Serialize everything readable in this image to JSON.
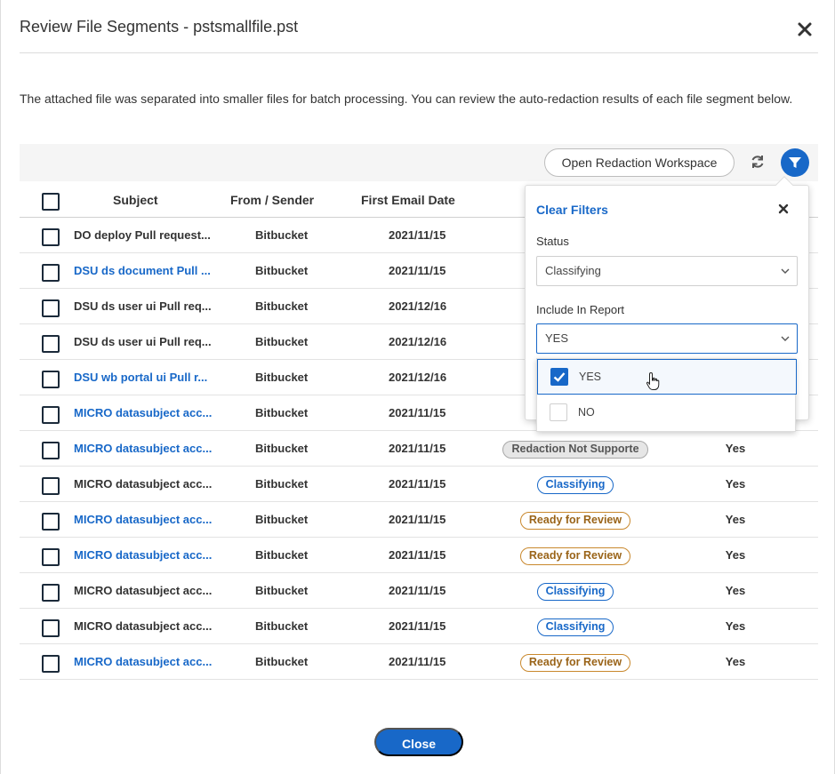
{
  "modal": {
    "title": "Review File Segments - pstsmallfile.pst",
    "description": "The attached file was separated into smaller files for batch processing. You can review the auto-redaction results of each file segment below."
  },
  "toolbar": {
    "open_workspace_label": "Open Redaction Workspace",
    "refresh_icon": "refresh-icon",
    "filter_icon": "filter-icon"
  },
  "table": {
    "columns": [
      "Subject",
      "From / Sender",
      "First Email Date"
    ],
    "rows": [
      {
        "subject": "DO deploy Pull request...",
        "link": false,
        "from": "Bitbucket",
        "date": "2021/11/15",
        "status": "",
        "status_type": "",
        "include": ""
      },
      {
        "subject": "DSU ds document Pull ...",
        "link": true,
        "from": "Bitbucket",
        "date": "2021/11/15",
        "status": "",
        "status_type": "review",
        "include": ""
      },
      {
        "subject": "DSU ds user ui Pull req...",
        "link": false,
        "from": "Bitbucket",
        "date": "2021/12/16",
        "status": "",
        "status_type": "",
        "include": ""
      },
      {
        "subject": "DSU ds user ui Pull req...",
        "link": false,
        "from": "Bitbucket",
        "date": "2021/12/16",
        "status": "",
        "status_type": "",
        "include": ""
      },
      {
        "subject": "DSU wb portal ui Pull r...",
        "link": true,
        "from": "Bitbucket",
        "date": "2021/12/16",
        "status": "",
        "status_type": "review",
        "include": ""
      },
      {
        "subject": "MICRO datasubject acc...",
        "link": true,
        "from": "Bitbucket",
        "date": "2021/11/15",
        "status": "",
        "status_type": "review",
        "include": ""
      },
      {
        "subject": "MICRO datasubject acc...",
        "link": true,
        "from": "Bitbucket",
        "date": "2021/11/15",
        "status": "Redaction Not Supporte",
        "status_type": "notsupported",
        "include": "Yes"
      },
      {
        "subject": "MICRO datasubject acc...",
        "link": false,
        "from": "Bitbucket",
        "date": "2021/11/15",
        "status": "Classifying",
        "status_type": "classifying",
        "include": "Yes"
      },
      {
        "subject": "MICRO datasubject acc...",
        "link": true,
        "from": "Bitbucket",
        "date": "2021/11/15",
        "status": "Ready for Review",
        "status_type": "review",
        "include": "Yes"
      },
      {
        "subject": "MICRO datasubject acc...",
        "link": true,
        "from": "Bitbucket",
        "date": "2021/11/15",
        "status": "Ready for Review",
        "status_type": "review",
        "include": "Yes"
      },
      {
        "subject": "MICRO datasubject acc...",
        "link": false,
        "from": "Bitbucket",
        "date": "2021/11/15",
        "status": "Classifying",
        "status_type": "classifying",
        "include": "Yes"
      },
      {
        "subject": "MICRO datasubject acc...",
        "link": false,
        "from": "Bitbucket",
        "date": "2021/11/15",
        "status": "Classifying",
        "status_type": "classifying",
        "include": "Yes"
      },
      {
        "subject": "MICRO datasubject acc...",
        "link": true,
        "from": "Bitbucket",
        "date": "2021/11/15",
        "status": "Ready for Review",
        "status_type": "review",
        "include": "Yes"
      }
    ]
  },
  "filter_panel": {
    "clear_label": "Clear Filters",
    "status_label": "Status",
    "status_value": "Classifying",
    "include_label": "Include In Report",
    "include_value": "YES",
    "options": [
      {
        "label": "YES",
        "checked": true
      },
      {
        "label": "NO",
        "checked": false
      }
    ]
  },
  "footer": {
    "close_label": "Close"
  },
  "colors": {
    "accent": "#1868c8",
    "review": "#c9882d",
    "not_supported_bg": "#e6e6e6"
  }
}
